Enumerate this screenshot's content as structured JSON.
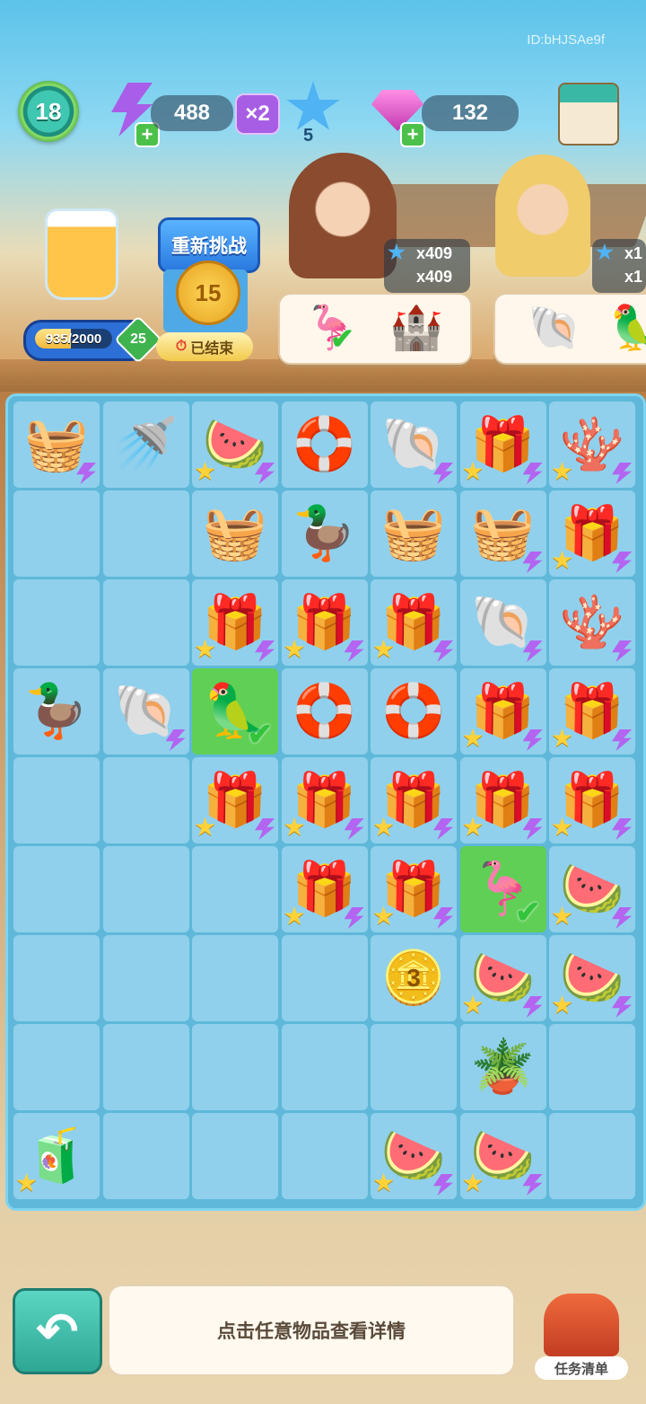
{
  "hud": {
    "id_text": "ID:bHJSAe9f",
    "level": "18",
    "energy": "488",
    "energy_multiplier": "×2",
    "stars": "5",
    "gems": "132",
    "shop_icon": "shop-icon"
  },
  "event": {
    "retry_label": "重新挑战",
    "coin_value": "15",
    "ended_label": "已结束",
    "progress_text": "935/2000",
    "progress_fraction": 0.4675,
    "progress_level": "25"
  },
  "orders": [
    {
      "stars_line1": "x409",
      "stars_line2": "x409",
      "items": [
        "flamingo-float",
        "sand-castle"
      ]
    },
    {
      "stars_line1": "x1",
      "stars_line2": "x1",
      "items": [
        "seashell",
        "parrot"
      ]
    }
  ],
  "board": {
    "cells": [
      [
        {
          "icon": "🧺",
          "star": false,
          "bolt": true
        },
        {
          "icon": "🚿",
          "star": false,
          "bolt": false
        },
        {
          "icon": "🍉",
          "star": true,
          "bolt": true
        },
        {
          "icon": "🛟",
          "star": false,
          "bolt": false
        },
        {
          "icon": "🐚",
          "star": false,
          "bolt": true
        },
        {
          "icon": "🎁",
          "star": true,
          "bolt": true
        },
        {
          "icon": "🪸",
          "star": true,
          "bolt": true
        }
      ],
      [
        {
          "icon": "",
          "star": false,
          "bolt": false
        },
        {
          "icon": "",
          "star": false,
          "bolt": false
        },
        {
          "icon": "🧺",
          "star": false,
          "bolt": false
        },
        {
          "icon": "🦆",
          "star": false,
          "bolt": false
        },
        {
          "icon": "🧺",
          "star": false,
          "bolt": false
        },
        {
          "icon": "🧺",
          "star": false,
          "bolt": true
        },
        {
          "icon": "🎁",
          "star": true,
          "bolt": true
        }
      ],
      [
        {
          "icon": "",
          "star": false,
          "bolt": false
        },
        {
          "icon": "",
          "star": false,
          "bolt": false
        },
        {
          "icon": "🎁",
          "star": true,
          "bolt": true
        },
        {
          "icon": "🎁",
          "star": true,
          "bolt": true
        },
        {
          "icon": "🎁",
          "star": true,
          "bolt": true
        },
        {
          "icon": "🐚",
          "star": false,
          "bolt": true
        },
        {
          "icon": "🪸",
          "star": false,
          "bolt": true
        }
      ],
      [
        {
          "icon": "🦆",
          "star": false,
          "bolt": false
        },
        {
          "icon": "🐚",
          "star": false,
          "bolt": true
        },
        {
          "icon": "🦜",
          "star": false,
          "bolt": false,
          "green": true,
          "check": true
        },
        {
          "icon": "🛟",
          "star": false,
          "bolt": false
        },
        {
          "icon": "🛟",
          "star": false,
          "bolt": false
        },
        {
          "icon": "🎁",
          "star": true,
          "bolt": true
        },
        {
          "icon": "🎁",
          "star": true,
          "bolt": true
        }
      ],
      [
        {
          "icon": "",
          "star": false,
          "bolt": false
        },
        {
          "icon": "",
          "star": false,
          "bolt": false
        },
        {
          "icon": "🎁",
          "star": true,
          "bolt": true
        },
        {
          "icon": "🎁",
          "star": true,
          "bolt": true
        },
        {
          "icon": "🎁",
          "star": true,
          "bolt": true
        },
        {
          "icon": "🎁",
          "star": true,
          "bolt": true
        },
        {
          "icon": "🎁",
          "star": true,
          "bolt": true
        }
      ],
      [
        {
          "icon": "",
          "star": false,
          "bolt": false
        },
        {
          "icon": "",
          "star": false,
          "bolt": false
        },
        {
          "icon": "",
          "star": false,
          "bolt": false
        },
        {
          "icon": "🎁",
          "star": true,
          "bolt": true
        },
        {
          "icon": "🎁",
          "star": true,
          "bolt": true
        },
        {
          "icon": "🦩",
          "star": false,
          "bolt": false,
          "green": true,
          "check": true
        },
        {
          "icon": "🍉",
          "star": true,
          "bolt": true
        }
      ],
      [
        {
          "icon": "",
          "star": false,
          "bolt": false
        },
        {
          "icon": "",
          "star": false,
          "bolt": false
        },
        {
          "icon": "",
          "star": false,
          "bolt": false
        },
        {
          "icon": "",
          "star": false,
          "bolt": false
        },
        {
          "icon": "🪙",
          "star": false,
          "bolt": false,
          "label": "3"
        },
        {
          "icon": "🍉",
          "star": true,
          "bolt": true
        },
        {
          "icon": "🍉",
          "star": true,
          "bolt": true
        }
      ],
      [
        {
          "icon": "",
          "star": false,
          "bolt": false
        },
        {
          "icon": "",
          "star": false,
          "bolt": false
        },
        {
          "icon": "",
          "star": false,
          "bolt": false
        },
        {
          "icon": "",
          "star": false,
          "bolt": false
        },
        {
          "icon": "",
          "star": false,
          "bolt": false
        },
        {
          "icon": "🪴",
          "star": false,
          "bolt": false
        },
        {
          "icon": "",
          "star": false,
          "bolt": false
        }
      ],
      [
        {
          "icon": "🧃",
          "star": true,
          "bolt": false
        },
        {
          "icon": "",
          "star": false,
          "bolt": false
        },
        {
          "icon": "",
          "star": false,
          "bolt": false
        },
        {
          "icon": "",
          "star": false,
          "bolt": false
        },
        {
          "icon": "🍉",
          "star": true,
          "bolt": true
        },
        {
          "icon": "🍉",
          "star": true,
          "bolt": true
        },
        {
          "icon": "",
          "star": false,
          "bolt": false
        }
      ]
    ]
  },
  "bottom": {
    "hint": "点击任意物品查看详情",
    "task_label": "任务清单"
  },
  "colors": {
    "board": "#5fb8d9",
    "cell": "#90d0ec",
    "cell_done": "#5fcf55",
    "accent": "#a75ee4"
  }
}
